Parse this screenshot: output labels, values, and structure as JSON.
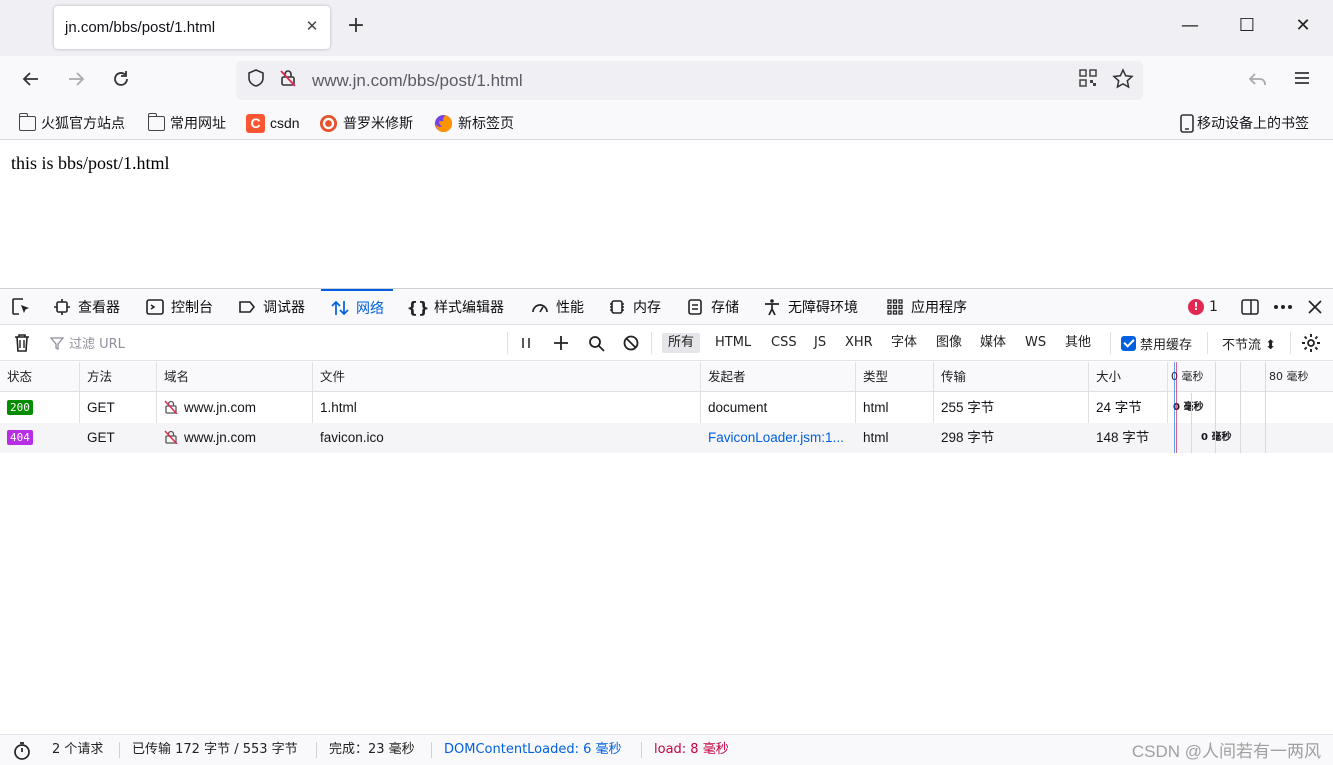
{
  "tab": {
    "title": "jn.com/bbs/post/1.html",
    "close": "✕",
    "new_tab": "+"
  },
  "window": {
    "minimize": "—",
    "maximize": "☐",
    "close": "✕"
  },
  "nav": {
    "url": "www.jn.com/bbs/post/1.html"
  },
  "bookmarks": [
    {
      "label": "火狐官方站点",
      "icon": "folder-icon"
    },
    {
      "label": "常用网址",
      "icon": "folder-icon"
    },
    {
      "label": "csdn",
      "icon": "csdn-icon"
    },
    {
      "label": "普罗米修斯",
      "icon": "target-icon"
    },
    {
      "label": "新标签页",
      "icon": "firefox-icon"
    }
  ],
  "mobile_bookmarks": "移动设备上的书签",
  "page": {
    "text": "this is bbs/post/1.html"
  },
  "devtools": {
    "tabs": [
      {
        "label": "查看器",
        "icon": "inspector-icon"
      },
      {
        "label": "控制台",
        "icon": "console-icon"
      },
      {
        "label": "调试器",
        "icon": "debugger-icon"
      },
      {
        "label": "网络",
        "icon": "network-icon"
      },
      {
        "label": "样式编辑器",
        "icon": "style-editor-icon"
      },
      {
        "label": "性能",
        "icon": "performance-icon"
      },
      {
        "label": "内存",
        "icon": "memory-icon"
      },
      {
        "label": "存储",
        "icon": "storage-icon"
      },
      {
        "label": "无障碍环境",
        "icon": "accessibility-icon"
      },
      {
        "label": "应用程序",
        "icon": "application-icon"
      }
    ],
    "error_count": "1",
    "filter_placeholder": "过滤 URL",
    "types": [
      "所有",
      "HTML",
      "CSS",
      "JS",
      "XHR",
      "字体",
      "图像",
      "媒体",
      "WS",
      "其他"
    ],
    "disable_cache": "禁用缓存",
    "throttle": "不节流 ⬍",
    "columns": [
      "状态",
      "方法",
      "域名",
      "文件",
      "发起者",
      "类型",
      "传输",
      "大小"
    ],
    "waterfall_ticks": [
      "0 毫秒",
      "80 毫秒"
    ],
    "rows": [
      {
        "status": "200",
        "status_color": "#058b00",
        "method": "GET",
        "domain": "www.jn.com",
        "file": "1.html",
        "initiator": "document",
        "type": "html",
        "transferred": "255 字节",
        "size": "24 字节",
        "timing": "0 毫秒"
      },
      {
        "status": "404",
        "status_color": "#b82ee5",
        "method": "GET",
        "domain": "www.jn.com",
        "file": "favicon.ico",
        "initiator": "FaviconLoader.jsm:1...",
        "type": "html",
        "transferred": "298 字节",
        "size": "148 字节",
        "timing": "0 毫秒"
      }
    ],
    "summary": {
      "requests": "2 个请求",
      "transferred": "已传输 172 字节 / 553 字节",
      "finish": "完成：23 毫秒",
      "dom_loaded": "DOMContentLoaded: 6 毫秒",
      "load": "load: 8 毫秒"
    }
  },
  "watermark": "CSDN @人间若有一两风",
  "colors": {
    "accent": "#0060df",
    "dom_loaded": "#0060df",
    "load": "#c50042"
  }
}
